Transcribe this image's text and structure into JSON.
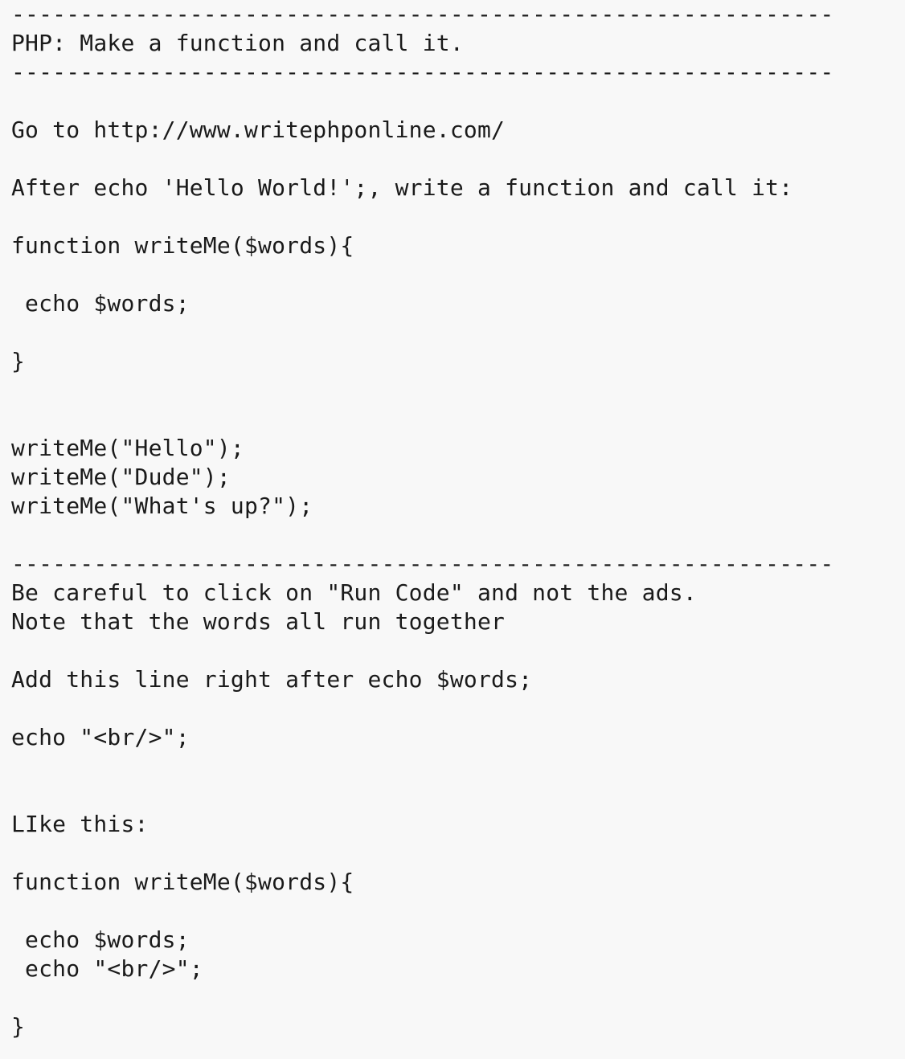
{
  "document": {
    "lines": [
      "------------------------------------------------------------",
      "PHP: Make a function and call it.",
      "------------------------------------------------------------",
      "",
      "Go to http://www.writephponline.com/",
      "",
      "After echo 'Hello World!';, write a function and call it:",
      "",
      "function writeMe($words){",
      "",
      " echo $words;",
      "",
      "}",
      "",
      "",
      "writeMe(\"Hello\");",
      "writeMe(\"Dude\");",
      "writeMe(\"What's up?\");",
      "",
      "------------------------------------------------------------",
      "Be careful to click on \"Run Code\" and not the ads.",
      "Note that the words all run together",
      "",
      "Add this line right after echo $words;",
      "",
      "echo \"<br/>\";",
      "",
      "",
      "LIke this:",
      "",
      "function writeMe($words){",
      "",
      " echo $words;",
      " echo \"<br/>\";",
      "",
      "}"
    ]
  }
}
